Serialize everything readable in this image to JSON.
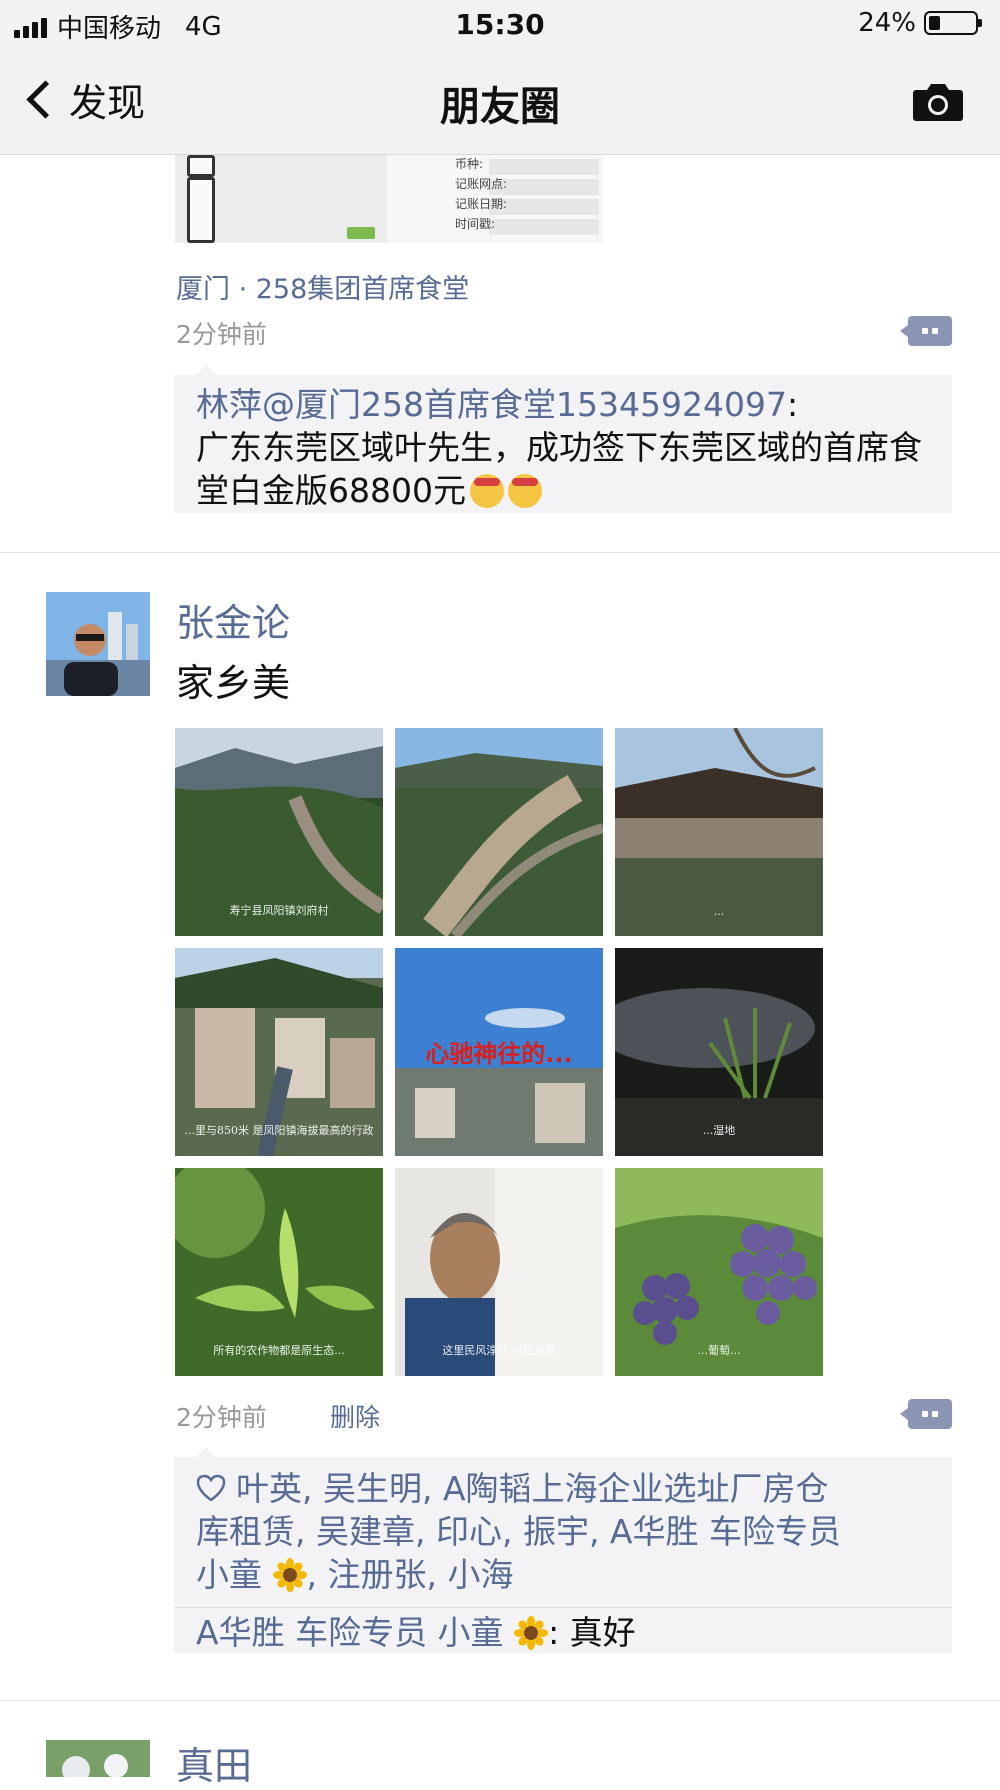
{
  "status_bar": {
    "carrier": "中国移动",
    "network": "4G",
    "time": "15:30",
    "battery": "24%"
  },
  "nav": {
    "back_label": "发现",
    "title": "朋友圈"
  },
  "posts": [
    {
      "location": "厦门 · 258集团首席食堂",
      "time": "2分钟前",
      "comment": {
        "author": "林萍@厦门258首席食堂15345924097",
        "text": "广东东莞区域叶先生，成功签下东莞区域的首席食堂白金版68800元"
      },
      "thumb_labels": [
        "币种:",
        "记账网点:",
        "记账日期:",
        "时间戳:"
      ]
    },
    {
      "author": "张金论",
      "text": "家乡美",
      "images": [
        {
          "icon": "mountain-valley-photo",
          "caption": "寿宁县凤阳镇刘府村"
        },
        {
          "icon": "terraced-valley-photo",
          "caption": ""
        },
        {
          "icon": "temple-roof-photo",
          "caption": "..."
        },
        {
          "icon": "village-town-photo",
          "caption": "...里与850米 是凤阳镇海拔最高的行政"
        },
        {
          "icon": "sky-red-text-photo",
          "caption": "心驰神往的..."
        },
        {
          "icon": "grass-river-photo",
          "caption": "...湿地"
        },
        {
          "icon": "tea-leaves-photo",
          "caption": "所有的农作物都是原生态..."
        },
        {
          "icon": "elderly-woman-photo",
          "caption": "这里民风淳朴 村民友善"
        },
        {
          "icon": "grapes-photo",
          "caption": "...葡萄..."
        }
      ],
      "time": "2分钟前",
      "delete_label": "删除",
      "likes_line1": "叶英, 吴生明, A陶韬上海企业选址厂房仓",
      "likes_line2": "库租赁, 吴建章, 印心, 振宇, A华胜 车险专员",
      "likes_line3_a": "小童",
      "likes_line3_b": ", 注册张, 小海",
      "comment_author": "A华胜 车险专员 小童",
      "comment_text": ": 真好"
    },
    {
      "author": "真田"
    }
  ],
  "colors": {
    "link": "#576b95",
    "bar": "#f2f2f2",
    "box": "#f3f3f5"
  }
}
